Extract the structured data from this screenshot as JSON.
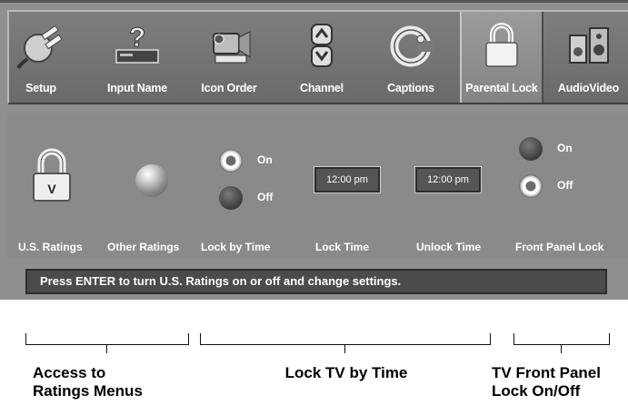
{
  "menu": {
    "items": [
      {
        "label": "Setup",
        "icon": "plug-icon"
      },
      {
        "label": "Input Name",
        "icon": "question-device-icon"
      },
      {
        "label": "Icon Order",
        "icon": "camcorder-icon"
      },
      {
        "label": "Channel",
        "icon": "up-down-arrows-icon"
      },
      {
        "label": "Captions",
        "icon": "cc-icon"
      },
      {
        "label": "Parental Lock",
        "icon": "padlock-icon",
        "selected": true
      },
      {
        "label": "AudioVideo",
        "icon": "speakers-icon"
      }
    ]
  },
  "panel": {
    "us_ratings_label": "U.S. Ratings",
    "us_ratings_icon_letter": "V",
    "other_ratings_label": "Other Ratings",
    "lock_by_time": {
      "label": "Lock by Time",
      "on": "On",
      "off": "Off",
      "selected": "On"
    },
    "lock_time": {
      "label": "Lock Time",
      "value": "12:00 pm"
    },
    "unlock_time": {
      "label": "Unlock Time",
      "value": "12:00 pm"
    },
    "front_panel_lock": {
      "label": "Front Panel Lock",
      "on": "On",
      "off": "Off",
      "selected": "Off"
    }
  },
  "status": "Press ENTER to turn U.S. Ratings on or off and change settings.",
  "annotations": {
    "access_ratings": "Access to Ratings Menus",
    "lock_tv_time": "Lock TV by Time",
    "front_panel": "TV Front Panel Lock On/Off"
  }
}
